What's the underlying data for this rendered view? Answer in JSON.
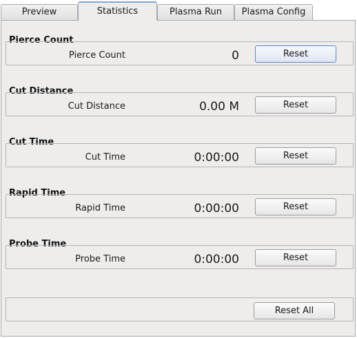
{
  "tabs": [
    {
      "label": "Preview"
    },
    {
      "label": "Statistics"
    },
    {
      "label": "Plasma Run"
    },
    {
      "label": "Plasma Config"
    }
  ],
  "statistics": [
    {
      "title": "Pierce Count",
      "label": "Pierce Count",
      "value": "0",
      "button": "Reset"
    },
    {
      "title": "Cut Distance",
      "label": "Cut Distance",
      "value": "0.00 M",
      "button": "Reset"
    },
    {
      "title": "Cut Time",
      "label": "Cut Time",
      "value": "0:00:00",
      "button": "Reset"
    },
    {
      "title": "Rapid Time",
      "label": "Rapid Time",
      "value": "0:00:00",
      "button": "Reset"
    },
    {
      "title": "Probe Time",
      "label": "Probe Time",
      "value": "0:00:00",
      "button": "Reset"
    }
  ],
  "reset_all": {
    "label": "Reset All"
  }
}
